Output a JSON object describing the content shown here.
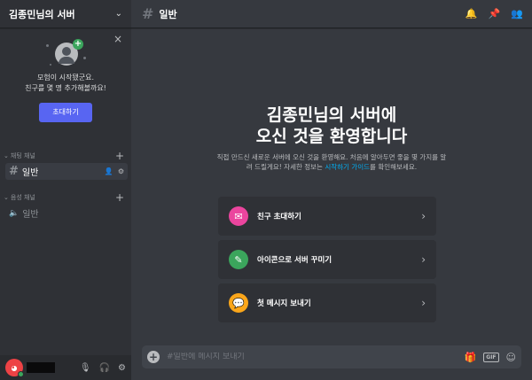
{
  "server": {
    "name": "김종민님의 서버"
  },
  "invite": {
    "line1": "모험이 시작됐군요.",
    "line2": "친구를 몇 명 추가해볼까요!",
    "button": "초대하기",
    "close": "×"
  },
  "categories": [
    {
      "label": "채팅 채널",
      "channels": [
        {
          "name": "일반",
          "active": true
        }
      ]
    },
    {
      "label": "음성 채널",
      "channels": [
        {
          "name": "일반",
          "active": false
        }
      ]
    }
  ],
  "topbar": {
    "channel": "일반"
  },
  "welcome": {
    "title_line1": "김종민님의 서버에",
    "title_line2": "오신 것을 환영합니다",
    "desc_main": "직접 만드신 새로운 서버에 오신 것을 환영해요. 처음에 알아두면 좋을 몇 가지를 알려 드릴게요! 자세한 정보는 ",
    "desc_link": "시작하기 가이드",
    "desc_tail": "를 확인해보세요."
  },
  "actions": [
    {
      "label": "친구 초대하기",
      "icon": "invite-icon",
      "color": "#eb459e"
    },
    {
      "label": "아이콘으로 서버 꾸미기",
      "icon": "brush-icon",
      "color": "#3ba55c"
    },
    {
      "label": "첫 메시지 보내기",
      "icon": "chat-icon",
      "color": "#faa61a"
    }
  ],
  "composer": {
    "placeholder": "#일반에 메시지 보내기",
    "gif": "GIF"
  },
  "colors": {
    "accent": "#5865f2",
    "link": "#00aff4",
    "online": "#3ba55c"
  }
}
